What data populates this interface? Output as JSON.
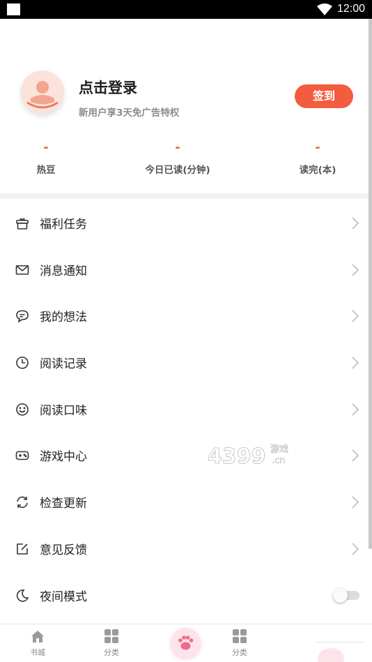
{
  "status_bar": {
    "time": "12:00"
  },
  "profile": {
    "title": "点击登录",
    "subtitle": "新用户享3天免广告特权",
    "signin_label": "签到"
  },
  "stats": [
    {
      "value": "-",
      "label": "热豆"
    },
    {
      "value": "-",
      "label": "今日已读(分钟)"
    },
    {
      "value": "-",
      "label": "读完(本)"
    }
  ],
  "menu": [
    {
      "label": "福利任务",
      "icon": "gift-icon"
    },
    {
      "label": "消息通知",
      "icon": "mail-icon"
    },
    {
      "label": "我的想法",
      "icon": "comment-icon"
    },
    {
      "label": "阅读记录",
      "icon": "clock-icon"
    },
    {
      "label": "阅读口味",
      "icon": "smile-icon"
    },
    {
      "label": "游戏中心",
      "icon": "gamepad-icon"
    },
    {
      "label": "检查更新",
      "icon": "refresh-icon"
    },
    {
      "label": "意见反馈",
      "icon": "edit-icon"
    },
    {
      "label": "夜间模式",
      "icon": "moon-icon",
      "toggle": false
    }
  ],
  "watermark": {
    "main": "4399",
    "suffix": "游戏",
    "domain": ".cn"
  },
  "bottom_nav": [
    {
      "label": "书城",
      "icon": "home-icon"
    },
    {
      "label": "分类",
      "icon": "grid-icon"
    },
    {
      "label": "",
      "icon": "paw-icon"
    },
    {
      "label": "分类",
      "icon": "grid-icon"
    }
  ],
  "colors": {
    "accent": "#f25c3f",
    "divider": "#f2f2f2",
    "text": "#222222",
    "muted": "#8c8c8c"
  }
}
